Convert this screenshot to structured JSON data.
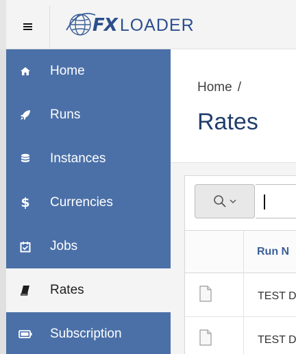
{
  "header": {
    "menu_icon": "hamburger-icon",
    "logo": {
      "fx": "FX",
      "loader": "LOADER",
      "icon": "globe-logo-icon",
      "color": "#2a4f8c"
    }
  },
  "sidebar": {
    "color": "#4b70a8",
    "items": [
      {
        "label": "Home",
        "icon": "home-icon"
      },
      {
        "label": "Runs",
        "icon": "rocket-icon"
      },
      {
        "label": "Instances",
        "icon": "database-icon"
      },
      {
        "label": "Currencies",
        "icon": "dollar-icon"
      },
      {
        "label": "Jobs",
        "icon": "calendar-check-icon"
      },
      {
        "label": "Rates",
        "icon": "book-icon",
        "active": true
      },
      {
        "label": "Subscription",
        "icon": "battery-icon"
      }
    ]
  },
  "main": {
    "breadcrumb": {
      "home": "Home",
      "separator": "/"
    },
    "title": "Rates",
    "search": {
      "icon": "search-icon",
      "dropdown_icon": "chevron-down-icon",
      "value": ""
    },
    "grid": {
      "column_header": "Run N",
      "rows": [
        {
          "text": "TEST D",
          "icon": "document-icon"
        },
        {
          "text": "TEST D",
          "icon": "document-icon"
        }
      ]
    }
  }
}
